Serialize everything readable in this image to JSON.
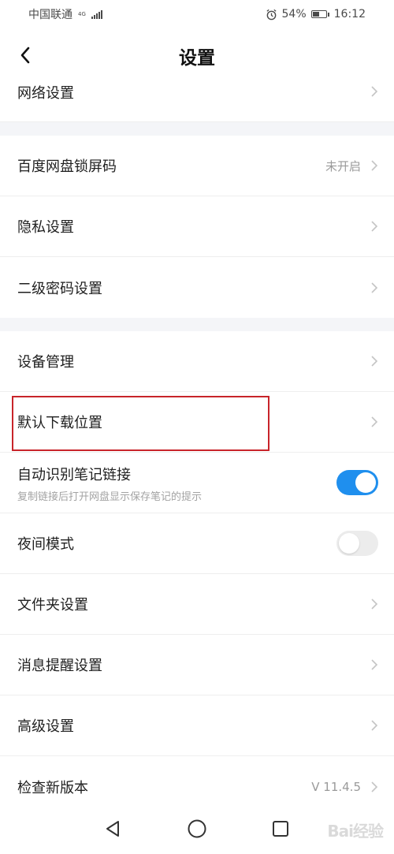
{
  "status_bar": {
    "carrier": "中国联通",
    "network_type": "4G",
    "battery_percent": "54%",
    "battery_level": 0.54,
    "time": "16:12"
  },
  "header": {
    "title": "设置"
  },
  "settings": {
    "network": {
      "label": "网络设置"
    },
    "lock_code": {
      "label": "百度网盘锁屏码",
      "value": "未开启"
    },
    "privacy": {
      "label": "隐私设置"
    },
    "second_password": {
      "label": "二级密码设置"
    },
    "device_management": {
      "label": "设备管理"
    },
    "download_location": {
      "label": "默认下载位置"
    },
    "note_link": {
      "label": "自动识别笔记链接",
      "sublabel": "复制链接后打开网盘显示保存笔记的提示",
      "enabled": true
    },
    "night_mode": {
      "label": "夜间模式",
      "enabled": false
    },
    "folder": {
      "label": "文件夹设置"
    },
    "notification": {
      "label": "消息提醒设置"
    },
    "advanced": {
      "label": "高级设置"
    },
    "check_update": {
      "label": "检查新版本",
      "value": "V 11.4.5"
    }
  },
  "colors": {
    "accent": "#1f8fee",
    "highlight": "#c8242a",
    "section_gap": "#f4f5f8"
  },
  "watermark": "Bai经验"
}
